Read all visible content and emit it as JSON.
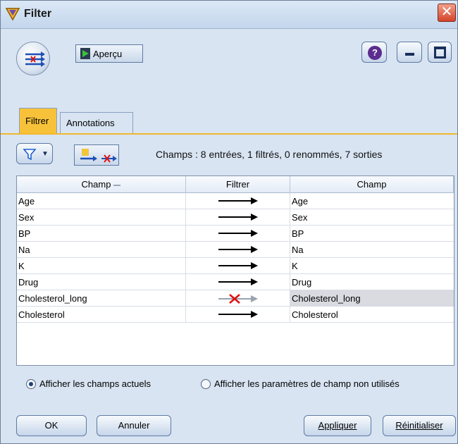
{
  "window": {
    "title": "Filter",
    "close_glyph": "✕"
  },
  "toolbar": {
    "preview_label": "Aperçu",
    "help_glyph": "?"
  },
  "tabs": [
    {
      "label": "Filtrer",
      "active": true
    },
    {
      "label": "Annotations",
      "active": false
    }
  ],
  "filter_panel": {
    "summary": "Champs : 8 entrées, 1 filtrés, 0 renommés, 7 sorties",
    "columns": [
      "Champ",
      "Filtrer",
      "Champ"
    ],
    "rows": [
      {
        "input": "Age",
        "filtered": false,
        "output": "Age"
      },
      {
        "input": "Sex",
        "filtered": false,
        "output": "Sex"
      },
      {
        "input": "BP",
        "filtered": false,
        "output": "BP"
      },
      {
        "input": "Na",
        "filtered": false,
        "output": "Na"
      },
      {
        "input": "K",
        "filtered": false,
        "output": "K"
      },
      {
        "input": "Drug",
        "filtered": false,
        "output": "Drug"
      },
      {
        "input": "Cholesterol_long",
        "filtered": true,
        "output": "Cholesterol_long"
      },
      {
        "input": "Cholesterol",
        "filtered": false,
        "output": "Cholesterol"
      }
    ],
    "radio_options": [
      {
        "label": "Afficher les champs actuels",
        "selected": true
      },
      {
        "label": "Afficher les paramètres de champ non utilisés",
        "selected": false
      }
    ]
  },
  "buttons": {
    "ok": "OK",
    "cancel": "Annuler",
    "apply": "Appliquer",
    "reset": "Réinitialiser"
  },
  "colors": {
    "active_tab": "#f7c23a",
    "window_bg": "#d8e4f2",
    "filtered_x": "#e01010"
  },
  "icons": {
    "title": "filter-node-icon",
    "node": "filter-node-icon",
    "preview": "play-icon",
    "help": "help-icon",
    "minimize": "minimize-icon",
    "maximize": "maximize-icon",
    "filter_menu": "funnel-icon",
    "toggle": "filter-toggle-icon",
    "arrow": "arrow-right-icon",
    "arrow_filtered": "arrow-crossed-icon"
  }
}
